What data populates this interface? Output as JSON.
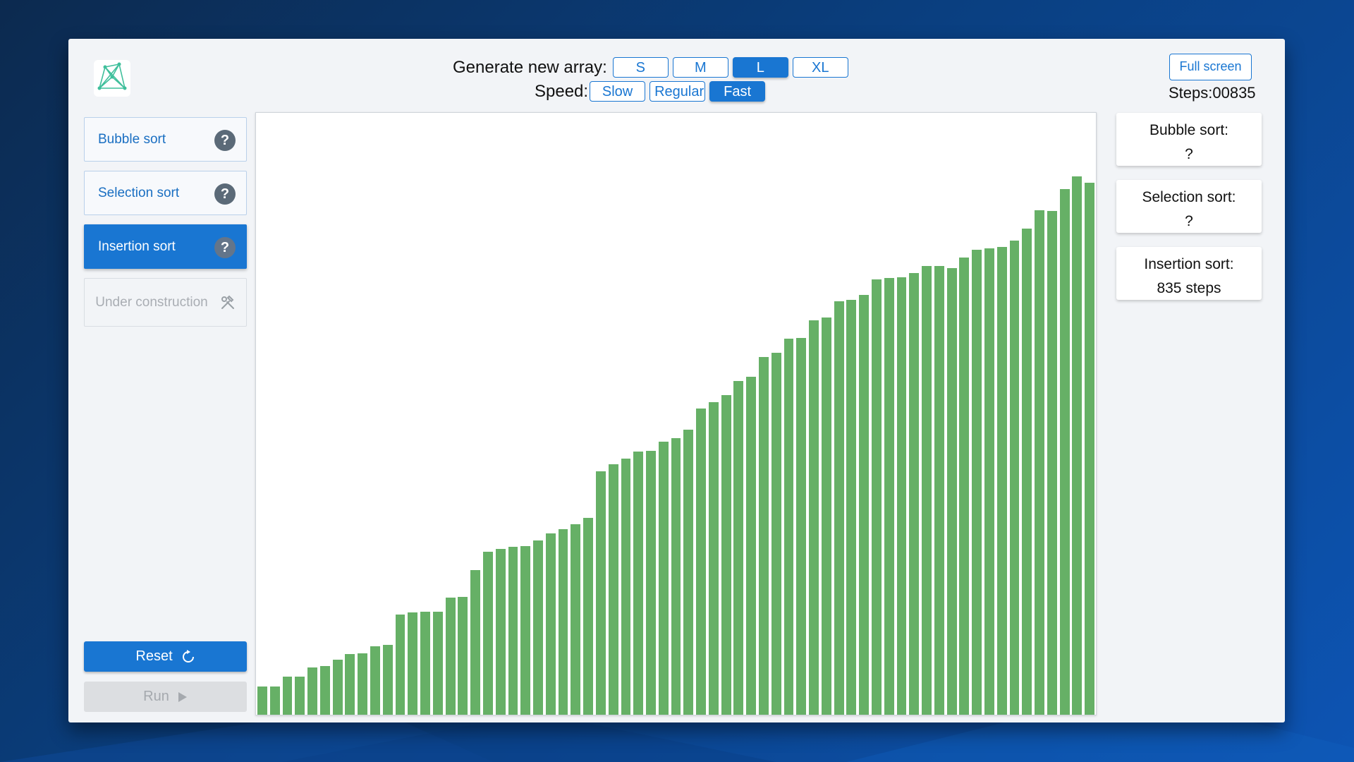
{
  "controls": {
    "generate_label": "Generate new array:",
    "sizes": [
      {
        "label": "S",
        "active": false
      },
      {
        "label": "M",
        "active": false
      },
      {
        "label": "L",
        "active": true
      },
      {
        "label": "XL",
        "active": false
      }
    ],
    "speed_label": "Speed:",
    "speeds": [
      {
        "label": "Slow",
        "active": false
      },
      {
        "label": "Regular",
        "active": false
      },
      {
        "label": "Fast",
        "active": true
      }
    ],
    "fullscreen_label": "Full screen",
    "steps_text": "Steps:00835"
  },
  "sidebar": {
    "algorithms": [
      {
        "label": "Bubble sort",
        "help": "?",
        "active": false
      },
      {
        "label": "Selection sort",
        "help": "?",
        "active": false
      },
      {
        "label": "Insertion sort",
        "help": "?",
        "active": true
      }
    ],
    "under_construction_label": "Under construction",
    "reset_label": "Reset",
    "run_label": "Run"
  },
  "results": [
    {
      "title": "Bubble sort:",
      "value": "?"
    },
    {
      "title": "Selection sort:",
      "value": "?"
    },
    {
      "title": "Insertion sort:",
      "value": "835 steps"
    }
  ],
  "colors": {
    "accent": "#1976d2",
    "bar": "#66b066",
    "help_badge": "#5b6a78"
  },
  "icons": {
    "logo": "network-graph-icon",
    "help": "question-mark-icon",
    "tools": "hammer-wrench-icon",
    "reset": "refresh-icon",
    "run": "play-icon"
  },
  "visualization": {
    "values": [
      47,
      47,
      63,
      63,
      79,
      81,
      92,
      101,
      102,
      114,
      116,
      166,
      170,
      171,
      171,
      195,
      196,
      240,
      271,
      275,
      279,
      280,
      289,
      301,
      308,
      316,
      327,
      404,
      416,
      426,
      437,
      438,
      454,
      459,
      474,
      509,
      519,
      531,
      554,
      562,
      594,
      601,
      625,
      626,
      655,
      660,
      687,
      689,
      697,
      723,
      726,
      727,
      734,
      746,
      746,
      742,
      760,
      772,
      775,
      777,
      788,
      808,
      838,
      837,
      873,
      895,
      884
    ]
  }
}
